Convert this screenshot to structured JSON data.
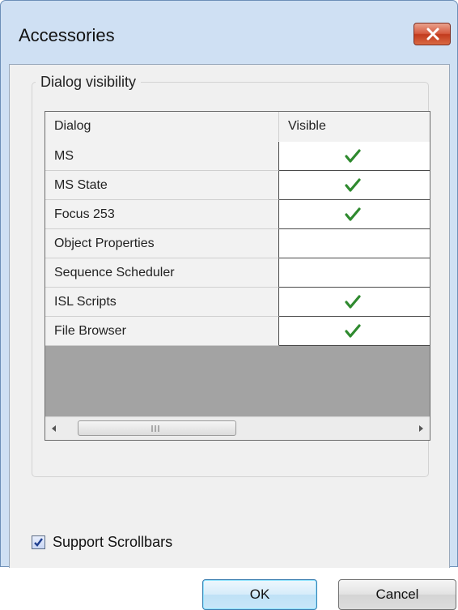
{
  "window": {
    "title": "Accessories",
    "close_icon": "close-icon"
  },
  "group": {
    "label": "Dialog visibility"
  },
  "grid": {
    "columns": [
      "Dialog",
      "Visible"
    ],
    "rows": [
      {
        "name": "MS",
        "visible": true
      },
      {
        "name": "MS State",
        "visible": true
      },
      {
        "name": "Focus 253",
        "visible": true
      },
      {
        "name": "Object Properties",
        "visible": false
      },
      {
        "name": "Sequence Scheduler",
        "visible": false
      },
      {
        "name": "ISL Scripts",
        "visible": true
      },
      {
        "name": "File Browser",
        "visible": true
      }
    ]
  },
  "options": {
    "support_scrollbars_label": "Support Scrollbars",
    "support_scrollbars_checked": true
  },
  "buttons": {
    "ok": "OK",
    "cancel": "Cancel"
  },
  "colors": {
    "check_green": "#2f8a2f",
    "title_bar": "#cfe0f3",
    "close_red": "#c94a2c"
  }
}
